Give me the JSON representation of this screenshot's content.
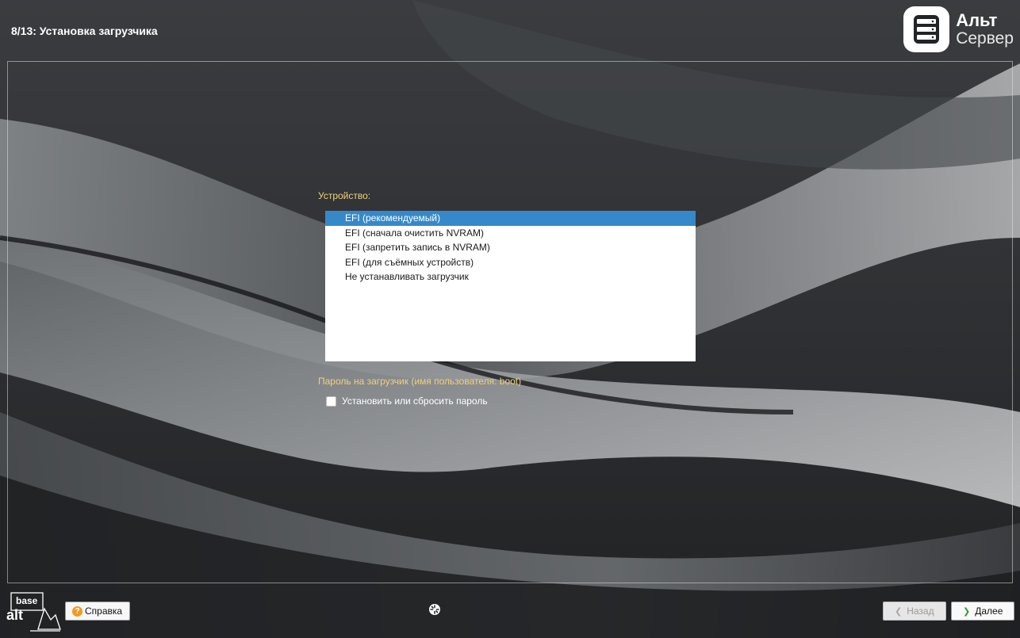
{
  "header": {
    "step_title": "8/13: Установка загрузчика"
  },
  "brand": {
    "name_line1": "Альт",
    "name_line2": "Сервер",
    "icon": "server-stack-icon"
  },
  "device_section": {
    "label": "Устройство:",
    "options": [
      "EFI (рекомендуемый)",
      "EFI (сначала очистить NVRAM)",
      "EFI (запретить запись в NVRAM)",
      "EFI (для съёмных устройств)",
      "Не устанавливать загрузчик"
    ],
    "selected_index": 0
  },
  "password_section": {
    "label": "Пароль на загрузчик (имя пользователя: boot)",
    "checkbox_label": "Установить или сбросить пароль",
    "checked": false
  },
  "footer": {
    "logo_top": "base",
    "logo_bottom": "alt",
    "help_label": "Справка",
    "back_label": "Назад",
    "next_label": "Далее",
    "back_enabled": false
  },
  "colors": {
    "selection": "#3589c9",
    "label_yellow": "#f0d27a",
    "help_icon": "#f39a1e",
    "next_arrow": "#2c9f3a"
  }
}
